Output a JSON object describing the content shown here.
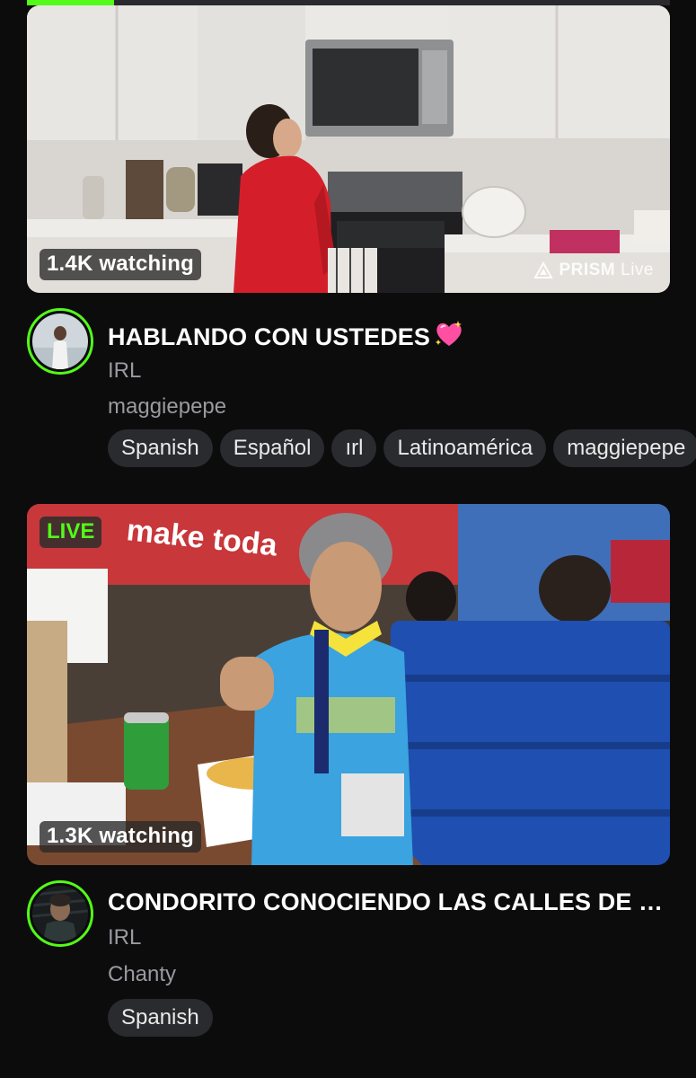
{
  "progress": {
    "fraction": 0.135,
    "color": "#53fc18"
  },
  "streams": [
    {
      "viewers": "1.4K watching",
      "live_label": "",
      "watermark_brand": "PRISM",
      "watermark_suffix": "Live",
      "title": "HABLANDO CON USTEDES",
      "title_emoji": "sparkling-heart-icon",
      "category": "IRL",
      "streamer": "maggiepepe",
      "tags": [
        "Spanish",
        "Español",
        "ırl",
        "Latinoamérica",
        "maggiepepe"
      ]
    },
    {
      "viewers": "1.3K watching",
      "live_label": "LIVE",
      "title": "CONDORITO CONOCIENDO LAS CALLES DE LA CIUDAD",
      "category": "IRL",
      "streamer": "Chanty",
      "tags": [
        "Spanish"
      ]
    }
  ],
  "colors": {
    "accent": "#53fc18",
    "background": "#0c0c0d",
    "muted_text": "#9a9aa0",
    "tag_bg": "#2a2b2f"
  }
}
